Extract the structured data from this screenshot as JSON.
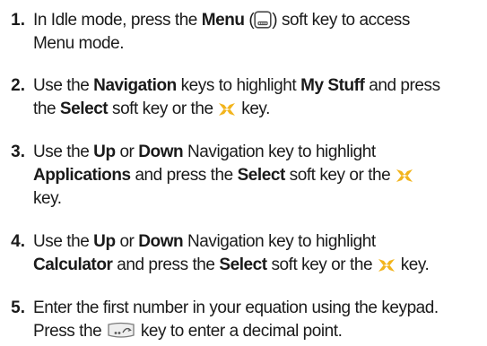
{
  "steps": [
    {
      "num": "1.",
      "lines": [
        [
          "In Idle mode, press the ",
          {
            "b": "Menu"
          },
          " (",
          {
            "icon": "menu"
          },
          ") soft key to access"
        ],
        [
          "Menu mode."
        ]
      ]
    },
    {
      "num": "2.",
      "lines": [
        [
          "Use the ",
          {
            "b": "Navigation"
          },
          " keys to highlight ",
          {
            "b": "My Stuff"
          },
          " and press"
        ],
        [
          "the ",
          {
            "b": "Select"
          },
          " soft key or the ",
          {
            "icon": "ok"
          },
          " key."
        ]
      ]
    },
    {
      "num": "3.",
      "lines": [
        [
          "Use the ",
          {
            "b": "Up"
          },
          " or ",
          {
            "b": "Down"
          },
          " Navigation key to highlight"
        ],
        [
          {
            "b": "Applications"
          },
          " and press the ",
          {
            "b": "Select"
          },
          " soft key or the ",
          {
            "icon": "ok"
          }
        ],
        [
          "key."
        ]
      ]
    },
    {
      "num": "4.",
      "lines": [
        [
          "Use the ",
          {
            "b": "Up"
          },
          " or ",
          {
            "b": "Down"
          },
          " Navigation key to highlight"
        ],
        [
          {
            "b": "Calculator"
          },
          " and press the ",
          {
            "b": "Select"
          },
          " soft key or the ",
          {
            "icon": "ok"
          },
          " key."
        ]
      ]
    },
    {
      "num": "5.",
      "lines": [
        [
          "Enter the first number in your equation using the keypad."
        ],
        [
          "Press the ",
          {
            "icon": "decimal"
          },
          " key to enter a decimal point."
        ]
      ]
    }
  ],
  "icons": {
    "menu": {
      "name": "menu-softkey-icon",
      "frame": "#4a4a4a"
    },
    "ok": {
      "name": "select-key-icon",
      "color": "#f2b41c"
    },
    "decimal": {
      "name": "decimal-key-icon",
      "frame": "#7a7a7a"
    }
  }
}
